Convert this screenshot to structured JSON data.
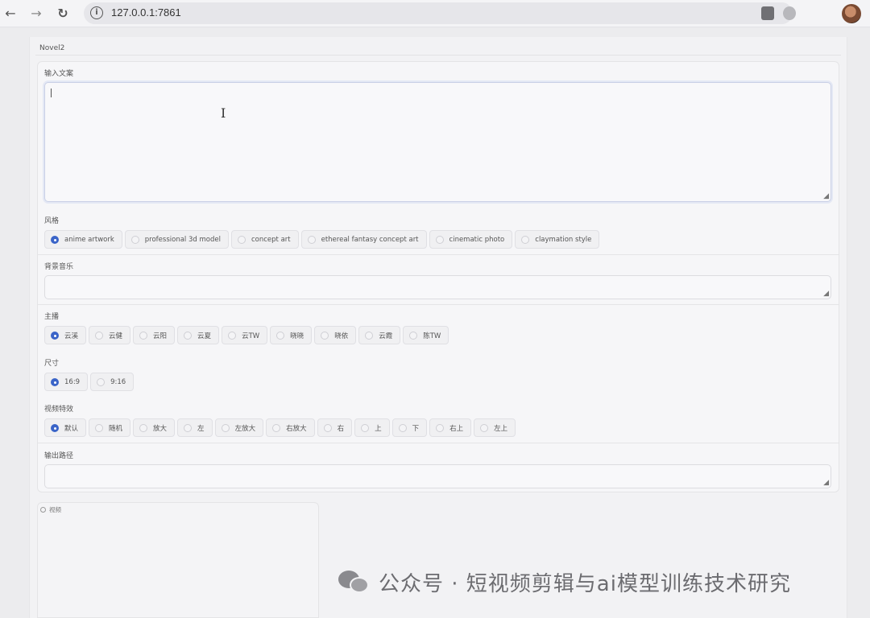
{
  "browser": {
    "url": "127.0.0.1:7861",
    "back_icon": "←",
    "forward_icon": "→",
    "reload_icon": "↻"
  },
  "tab": {
    "label": "Novel2"
  },
  "input_text": {
    "label": "输入文案",
    "value": ""
  },
  "style": {
    "label": "风格",
    "options": [
      "anime artwork",
      "professional 3d model",
      "concept art",
      "ethereal fantasy concept art",
      "cinematic photo",
      "claymation style"
    ],
    "selected": "anime artwork"
  },
  "bgm": {
    "label": "背景音乐",
    "value": ""
  },
  "host": {
    "label": "主播",
    "options": [
      "云溪",
      "云健",
      "云阳",
      "云夏",
      "云TW",
      "晓晓",
      "晓依",
      "云霞",
      "陈TW"
    ],
    "selected": "云溪"
  },
  "size": {
    "label": "尺寸",
    "options": [
      "16:9",
      "9:16"
    ],
    "selected": "16:9"
  },
  "effect": {
    "label": "视频特效",
    "options": [
      "默认",
      "随机",
      "放大",
      "左",
      "左放大",
      "右放大",
      "右",
      "上",
      "下",
      "右上",
      "左上"
    ],
    "selected": "默认"
  },
  "output_path": {
    "label": "输出路径",
    "value": ""
  },
  "video": {
    "label": "视频"
  },
  "watermark": {
    "text": "公众号 · 短视频剪辑与ai模型训练技术研究"
  },
  "colors": {
    "accent": "#3a64c8"
  }
}
